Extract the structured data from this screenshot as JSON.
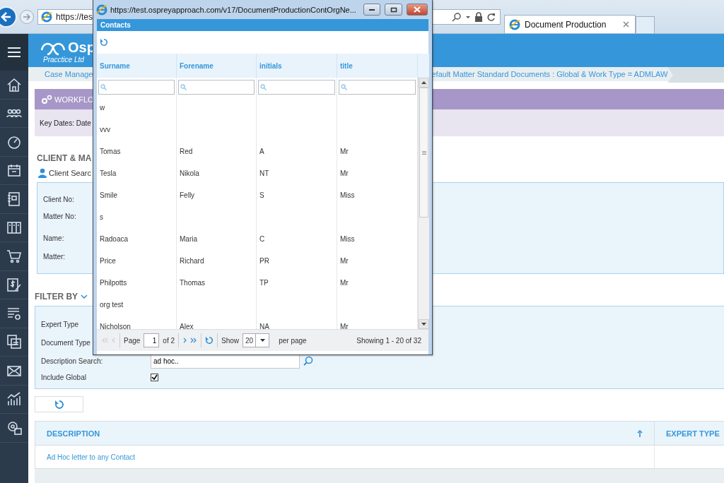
{
  "browser": {
    "address": "https://tes",
    "tab": {
      "title": "Document Production"
    }
  },
  "app": {
    "logo": {
      "name": "Osp",
      "subtitle": "Pracctice Ltd"
    },
    "breadcrumb": [
      "Case Manage",
      "efault Matter Standard Documents : Global & Work Type = ADMLAW"
    ],
    "workflow": {
      "title": "WORKFLO",
      "text": "Key Dates: Date"
    },
    "client_matter": {
      "heading": "CLIENT & MA",
      "search_link": "Client Searc",
      "fields": [
        "Client No:",
        "Matter No:",
        "Name:",
        "Matter:"
      ]
    },
    "filter": {
      "heading": "FILTER BY",
      "rows": [
        {
          "kind": "label",
          "label": "Expert Type"
        },
        {
          "kind": "label",
          "label": "Document Type"
        },
        {
          "kind": "search",
          "label": "Description Search:",
          "value": "ad hoc.."
        },
        {
          "kind": "checkbox",
          "label": "Include Global",
          "checked": true
        }
      ]
    },
    "table": {
      "columns": [
        "DESCRIPTION",
        "EXPERT TYPE"
      ],
      "rows": [
        "Ad Hoc letter to any Contact"
      ]
    }
  },
  "popup": {
    "title": "https://test.ospreyapproach.com/v17/DocumentProductionContOrgNe...",
    "panel_title": "Contacts",
    "columns": [
      "Surname",
      "Forename",
      "initials",
      "title"
    ],
    "rows": [
      [
        "w",
        "",
        "",
        ""
      ],
      [
        "vvv",
        "",
        "",
        ""
      ],
      [
        "Tomas",
        "Red",
        "A",
        "Mr"
      ],
      [
        "Tesla",
        "Nikola",
        "NT",
        "Mr"
      ],
      [
        "Smile",
        "Felly",
        "S",
        "Miss"
      ],
      [
        "s",
        "",
        "",
        ""
      ],
      [
        "Radoaca",
        "Maria",
        "C",
        "Miss"
      ],
      [
        "Price",
        "Richard",
        "PR",
        "Mr"
      ],
      [
        "Philpotts",
        "Thomas",
        "TP",
        "Mr"
      ],
      [
        "org test",
        "",
        "",
        ""
      ],
      [
        "Nicholson",
        "Alex",
        "NA",
        "Mr"
      ]
    ],
    "pager": {
      "page_label": "Page",
      "page": "1",
      "of": "of 2",
      "show_label": "Show",
      "page_size": "20",
      "per_page": "per page",
      "summary": "Showing 1 - 20 of 32"
    }
  }
}
